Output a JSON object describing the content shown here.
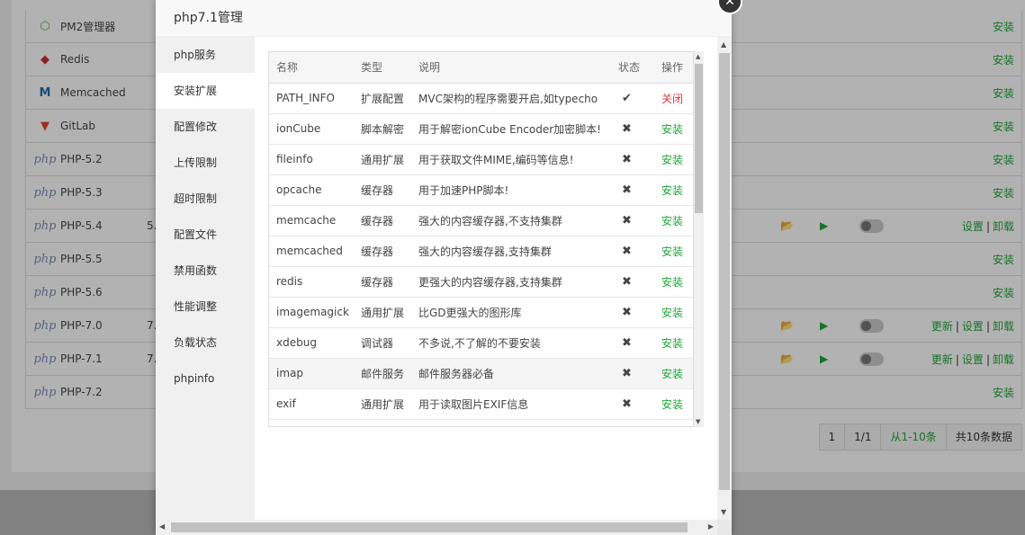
{
  "background": {
    "rows": [
      {
        "name": "PM2管理器",
        "logo": "nodejs-icon",
        "version": "",
        "ops": [
          "安装"
        ],
        "controls": false
      },
      {
        "name": "Redis",
        "logo": "redis-icon",
        "version": "",
        "ops": [
          "安装"
        ],
        "controls": false
      },
      {
        "name": "Memcached",
        "logo": "memcached-icon",
        "version": "",
        "ops": [
          "安装"
        ],
        "controls": false
      },
      {
        "name": "GitLab",
        "logo": "gitlab-icon",
        "version": "",
        "ops": [
          "安装"
        ],
        "controls": false
      },
      {
        "name": "PHP-5.2",
        "logo": "php-icon",
        "version": "",
        "ops": [
          "安装"
        ],
        "controls": false
      },
      {
        "name": "PHP-5.3",
        "logo": "php-icon",
        "version": "",
        "ops": [
          "安装"
        ],
        "controls": false
      },
      {
        "name": "PHP-5.4",
        "logo": "php-icon",
        "version": "5.",
        "ops": [
          "设置",
          "卸载"
        ],
        "controls": true
      },
      {
        "name": "PHP-5.5",
        "logo": "php-icon",
        "version": "",
        "ops": [
          "安装"
        ],
        "controls": false
      },
      {
        "name": "PHP-5.6",
        "logo": "php-icon",
        "version": "",
        "ops": [
          "安装"
        ],
        "controls": false
      },
      {
        "name": "PHP-7.0",
        "logo": "php-icon",
        "version": "7.",
        "ops": [
          "更新",
          "设置",
          "卸载"
        ],
        "controls": true
      },
      {
        "name": "PHP-7.1",
        "logo": "php-icon",
        "version": "7.",
        "ops": [
          "更新",
          "设置",
          "卸载"
        ],
        "controls": true
      },
      {
        "name": "PHP-7.2",
        "logo": "php-icon",
        "version": "",
        "ops": [
          "安装"
        ],
        "controls": false
      }
    ],
    "pager": {
      "current": "1",
      "pages": "1/1",
      "range": "从1-10条",
      "total": "共10条数据"
    },
    "php_logo_text": "php"
  },
  "modal": {
    "title": "php7.1管理",
    "close_glyph": "✕",
    "menu": [
      "php服务",
      "安装扩展",
      "配置修改",
      "上传限制",
      "超时限制",
      "配置文件",
      "禁用函数",
      "性能调整",
      "负载状态",
      "phpinfo"
    ],
    "active_menu_index": 1,
    "table": {
      "headers": [
        "名称",
        "类型",
        "说明",
        "状态",
        "操作"
      ],
      "rows": [
        {
          "name": "PATH_INFO",
          "type": "扩展配置",
          "desc": "MVC架构的程序需要开启,如typecho",
          "status": "✔",
          "op": "关闭",
          "op_kind": "close"
        },
        {
          "name": "ionCube",
          "type": "脚本解密",
          "desc": "用于解密ionCube Encoder加密脚本!",
          "status": "✖",
          "op": "安装",
          "op_kind": "install"
        },
        {
          "name": "fileinfo",
          "type": "通用扩展",
          "desc": "用于获取文件MIME,编码等信息!",
          "status": "✖",
          "op": "安装",
          "op_kind": "install"
        },
        {
          "name": "opcache",
          "type": "缓存器",
          "desc": "用于加速PHP脚本!",
          "status": "✖",
          "op": "安装",
          "op_kind": "install"
        },
        {
          "name": "memcache",
          "type": "缓存器",
          "desc": "强大的内容缓存器,不支持集群",
          "status": "✖",
          "op": "安装",
          "op_kind": "install"
        },
        {
          "name": "memcached",
          "type": "缓存器",
          "desc": "强大的内容缓存器,支持集群",
          "status": "✖",
          "op": "安装",
          "op_kind": "install"
        },
        {
          "name": "redis",
          "type": "缓存器",
          "desc": "更强大的内容缓存器,支持集群",
          "status": "✖",
          "op": "安装",
          "op_kind": "install"
        },
        {
          "name": "imagemagick",
          "type": "通用扩展",
          "desc": "比GD更强大的图形库",
          "status": "✖",
          "op": "安装",
          "op_kind": "install"
        },
        {
          "name": "xdebug",
          "type": "调试器",
          "desc": "不多说,不了解的不要安装",
          "status": "✖",
          "op": "安装",
          "op_kind": "install"
        },
        {
          "name": "imap",
          "type": "邮件服务",
          "desc": "邮件服务器必备",
          "status": "✖",
          "op": "安装",
          "op_kind": "install"
        },
        {
          "name": "exif",
          "type": "通用扩展",
          "desc": "用于读取图片EXIF信息",
          "status": "✖",
          "op": "安装",
          "op_kind": "install"
        }
      ],
      "highlighted_row_index": 9
    }
  },
  "colors": {
    "accent_green": "#20a53a",
    "close_red": "#e03a3a"
  }
}
